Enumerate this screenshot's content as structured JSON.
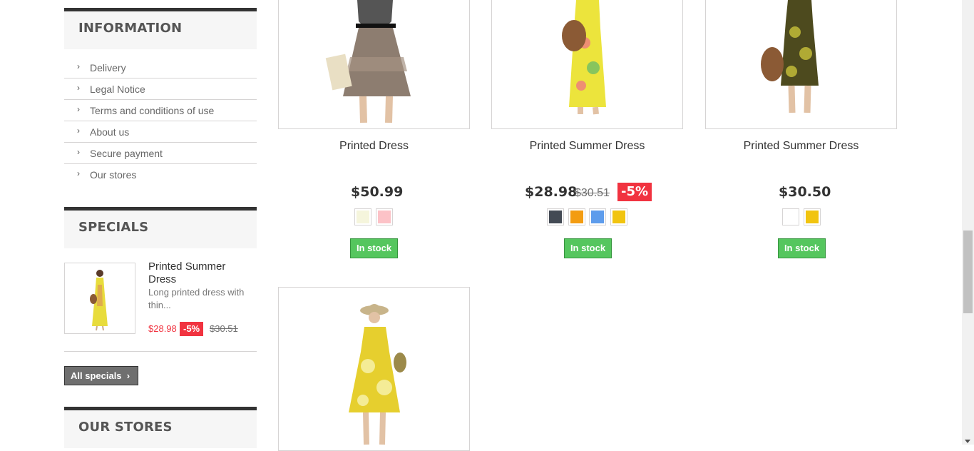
{
  "sidebar": {
    "information_title": "INFORMATION",
    "information_links": [
      "Delivery",
      "Legal Notice",
      "Terms and conditions of use",
      "About us",
      "Secure payment",
      "Our stores"
    ],
    "specials_title": "SPECIALS",
    "special": {
      "name": "Printed Summer Dress",
      "description": "Long printed dress with thin...",
      "price": "$28.98",
      "discount": "-5%",
      "old_price": "$30.51"
    },
    "all_specials_label": "All specials",
    "stores_title": "OUR STORES"
  },
  "products": [
    {
      "name": "Printed Dress",
      "price": "$50.99",
      "old_price": "",
      "discount": "",
      "colors": [
        "#f5f5dc",
        "#fcc2c7"
      ],
      "availability": "In stock"
    },
    {
      "name": "Printed Summer Dress",
      "price": "$28.98",
      "old_price": "$30.51",
      "discount": "-5%",
      "colors": [
        "#434a54",
        "#f39c11",
        "#5d9cec",
        "#f1c40f"
      ],
      "availability": "In stock"
    },
    {
      "name": "Printed Summer Dress",
      "price": "$30.50",
      "old_price": "",
      "discount": "",
      "colors": [
        "#ffffff",
        "#f1c40f"
      ],
      "availability": "In stock"
    }
  ],
  "icons": {
    "chevron": "chevron-right-icon"
  },
  "colors": {
    "accent_red": "#f13340",
    "stock_green": "#55c65e",
    "dark": "#333333"
  }
}
